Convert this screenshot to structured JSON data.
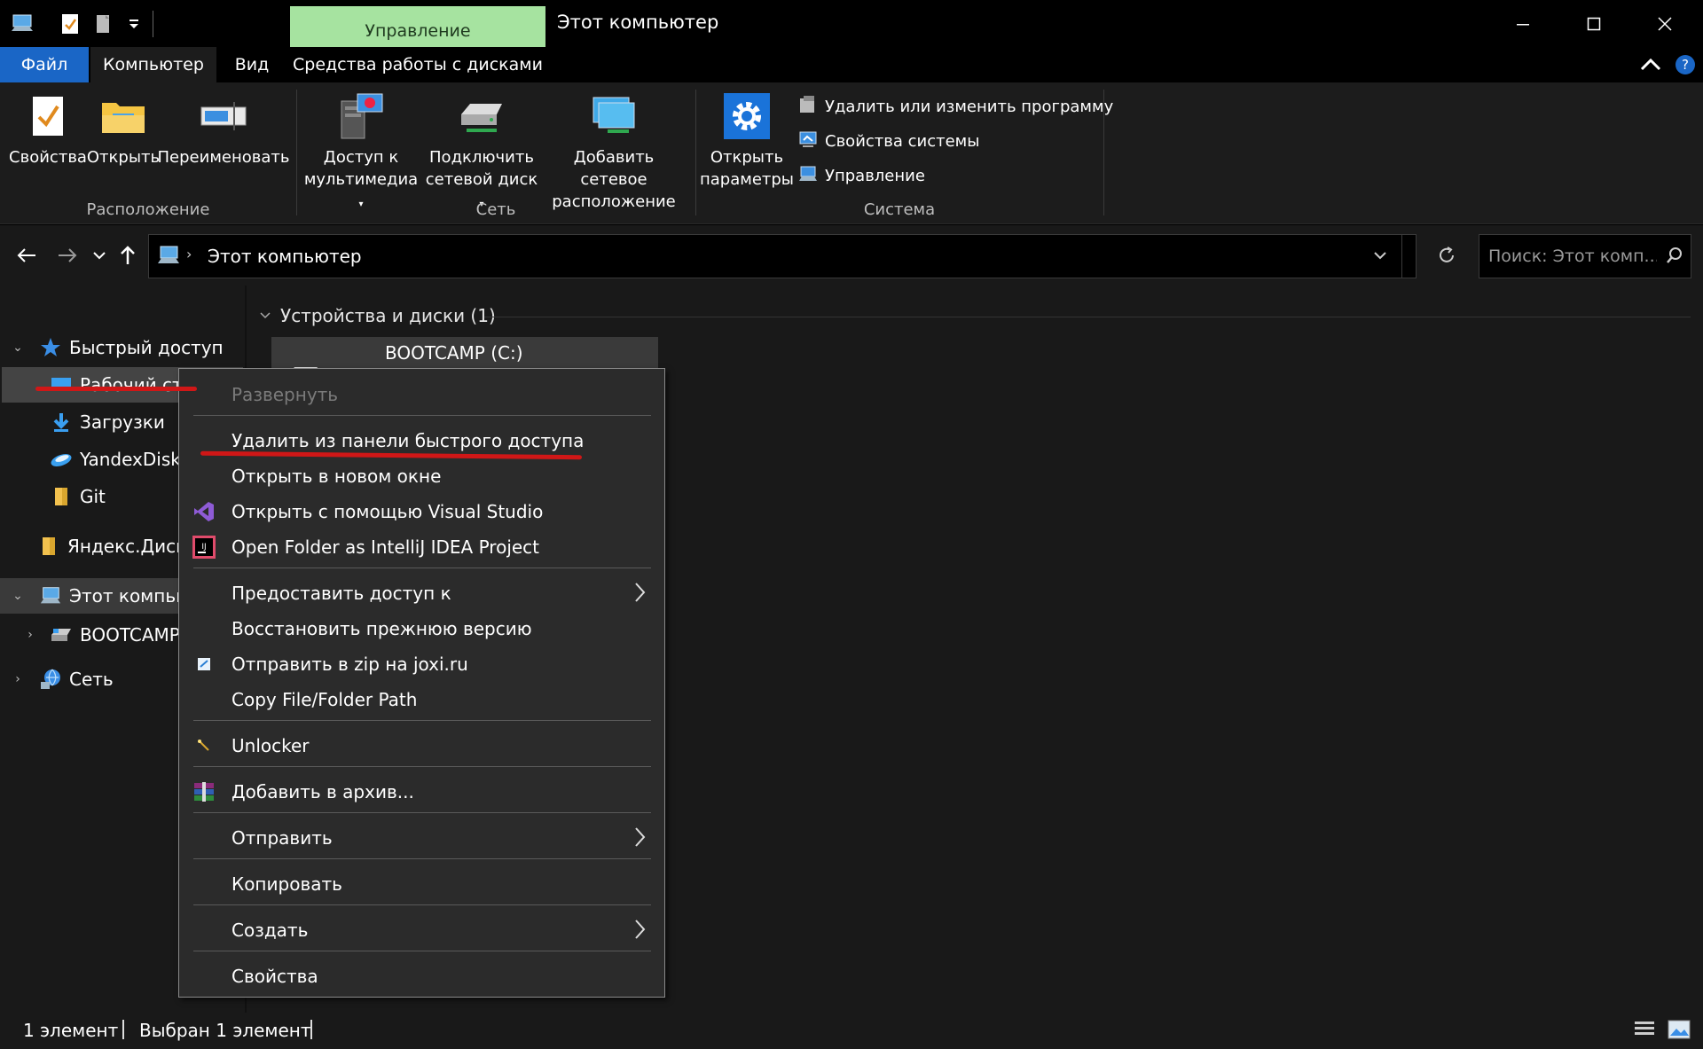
{
  "window": {
    "title": "Этот компьютер",
    "contextual_tab": "Управление"
  },
  "ribbon_tabs": {
    "file": "Файл",
    "computer": "Компьютер",
    "view": "Вид",
    "disk_tools": "Средства работы с дисками"
  },
  "ribbon": {
    "groups": {
      "location": "Расположение",
      "network": "Сеть",
      "system": "Система"
    },
    "location": {
      "properties": "Свойства",
      "open": "Открыть",
      "rename": "Переименовать"
    },
    "network": {
      "media_line1": "Доступ к",
      "media_line2": "мультимедиа",
      "map_line1": "Подключить",
      "map_line2": "сетевой диск",
      "add_line1": "Добавить сетевое",
      "add_line2": "расположение"
    },
    "system": {
      "settings_line1": "Открыть",
      "settings_line2": "параметры",
      "uninstall": "Удалить или изменить программу",
      "sys_props": "Свойства системы",
      "manage": "Управление"
    }
  },
  "address": {
    "path": "Этот компьютер",
    "search_placeholder": "Поиск: Этот комп..."
  },
  "nav": {
    "quick_access": "Быстрый доступ",
    "desktop": "Рабочий стол",
    "downloads": "Загрузки",
    "yandexdisk": "YandexDisk",
    "git": "Git",
    "yandex_disk_ru": "Яндекс.Диск",
    "this_pc": "Этот компьютер",
    "bootcamp": "BOOTCAMP (C:)",
    "network": "Сеть"
  },
  "content": {
    "group_header": "Устройства и диски (1)",
    "drive_name": "BOOTCAMP (C:)"
  },
  "context_menu": {
    "expand": "Развернуть",
    "remove_quick": "Удалить из панели быстрого доступа",
    "open_new_window": "Открыть в новом окне",
    "open_vs": "Открыть с помощью Visual Studio",
    "open_idea": "Open Folder as IntelliJ IDEA Project",
    "share": "Предоставить доступ к",
    "restore": "Восстановить прежнюю версию",
    "joxi": "Отправить в zip на joxi.ru",
    "copy_path": "Copy File/Folder Path",
    "unlocker": "Unlocker",
    "archive": "Добавить в архив...",
    "send_to": "Отправить",
    "copy": "Копировать",
    "create": "Создать",
    "properties": "Свойства"
  },
  "status": {
    "items": "1 элемент",
    "selected": "Выбран 1 элемент"
  },
  "colors": {
    "accent_blue": "#1a66c6",
    "manage_green": "#a6e3a0",
    "annotation_red": "#d01717"
  }
}
